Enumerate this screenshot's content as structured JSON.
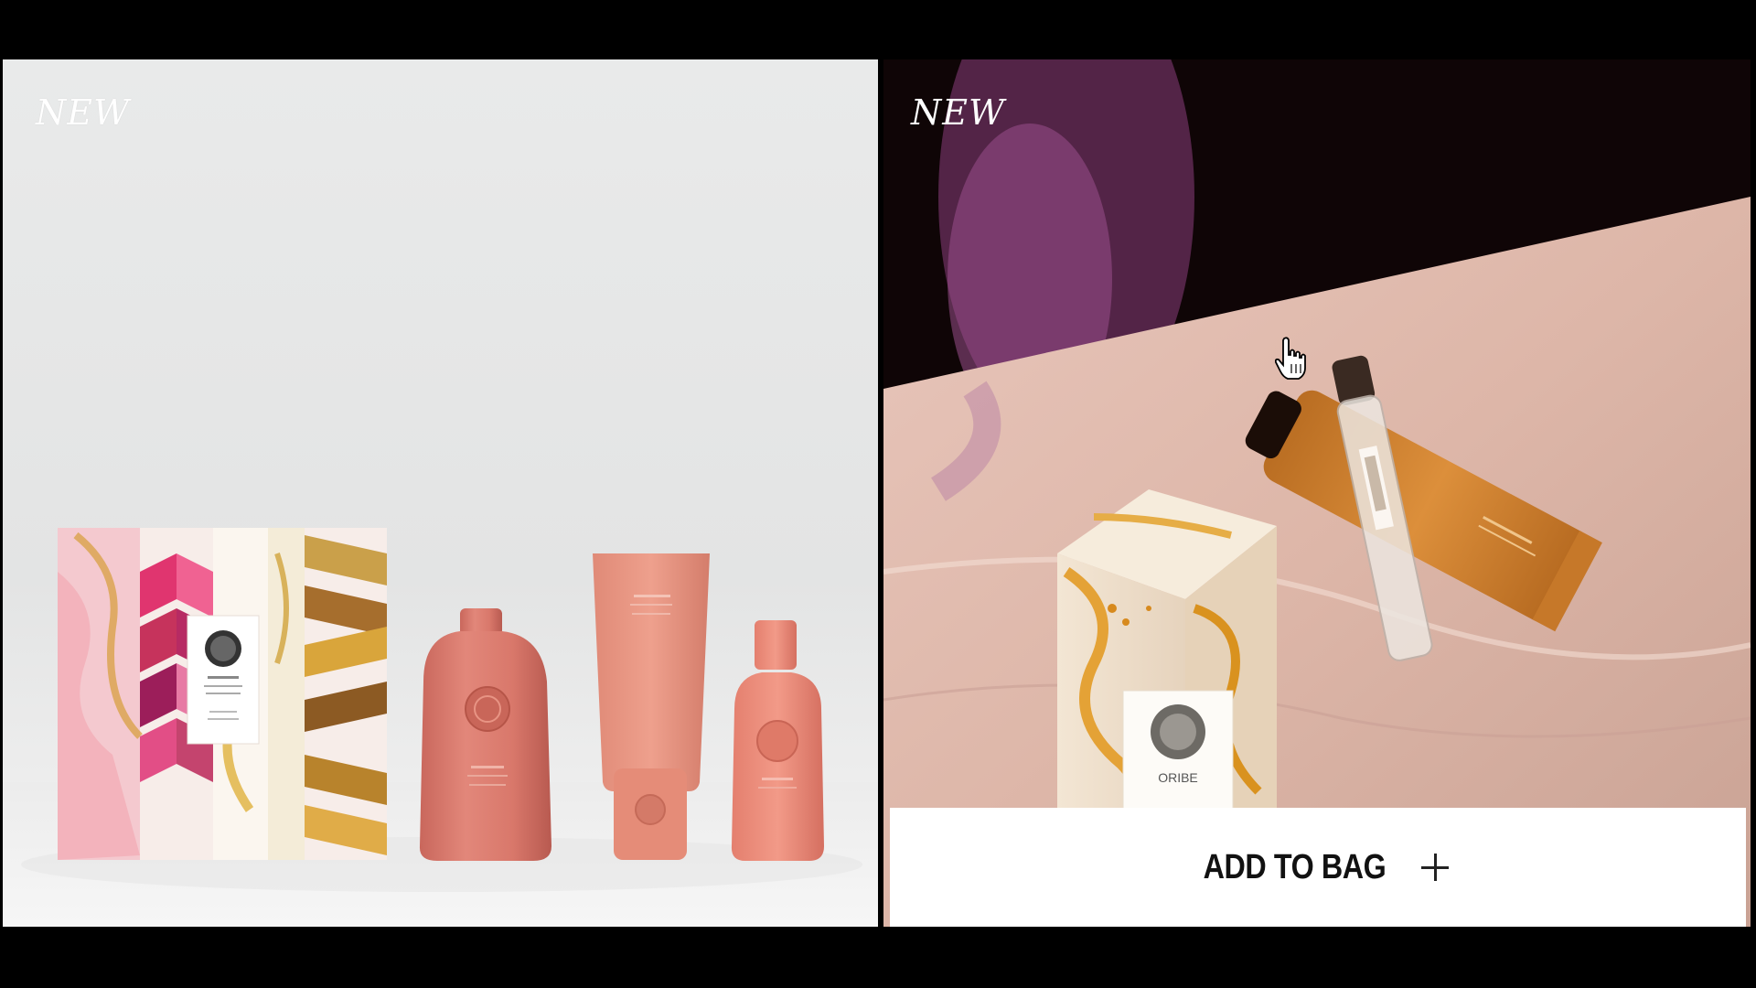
{
  "tiles": [
    {
      "badge": "NEW",
      "image_subject": "pink hair care gift set with marbled box, shampoo bottle, tube and small bottle",
      "box_brand": "ORIBE",
      "box_title": "Bright Blonde"
    },
    {
      "badge": "NEW",
      "image_subject": "marbled gift box, orange hand cream tube and rollerball on pink marble surface",
      "box_brand": "ORIBE",
      "add_to_bag_label": "ADD TO BAG"
    }
  ],
  "icons": {
    "plus": "plus-icon",
    "cursor": "hand-pointer-icon"
  },
  "colors": {
    "background": "#000000",
    "button_bg": "#ffffff",
    "button_text": "#111111",
    "badge_text": "#ffffff"
  }
}
